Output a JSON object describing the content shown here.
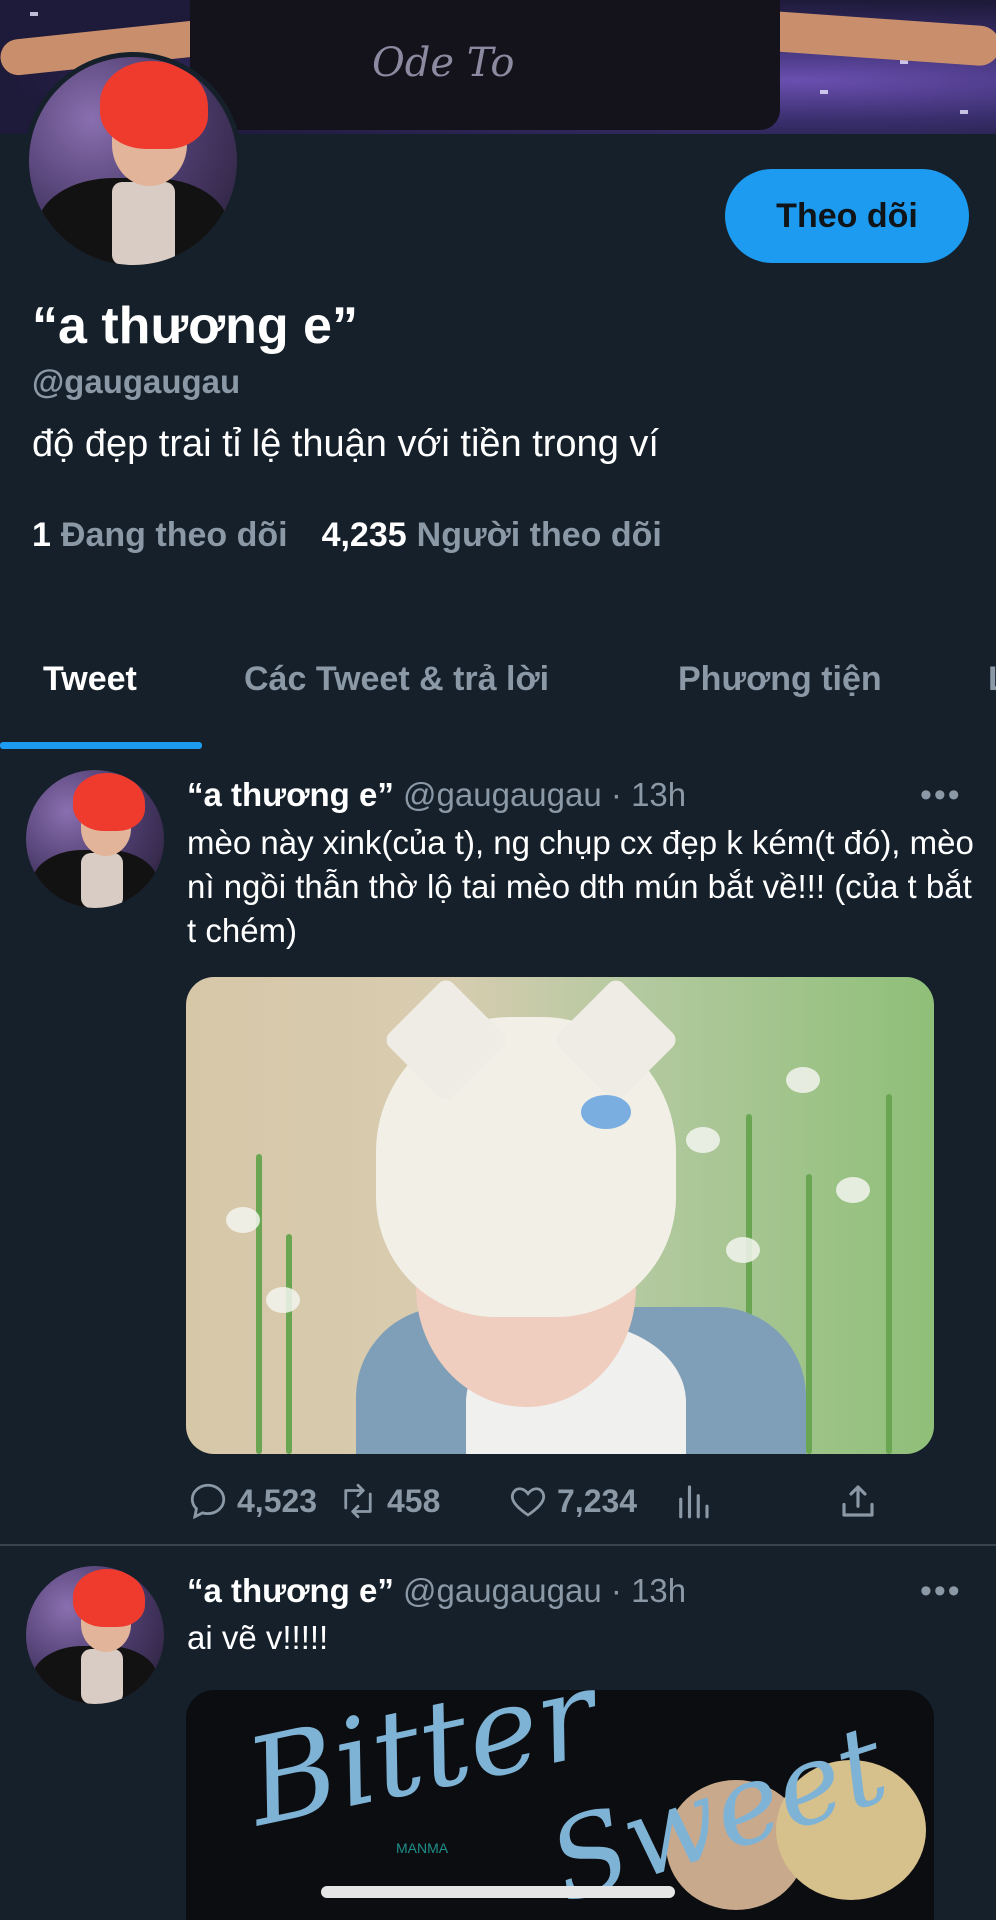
{
  "banner": {
    "signature": "Ode To"
  },
  "profile": {
    "follow_label": "Theo dõi",
    "display_name": "“a thương e”",
    "handle": "@gaugaugau",
    "bio": "độ đẹp trai tỉ lệ thuận với tiền trong ví",
    "following_count": "1",
    "following_label": "Đang theo dõi",
    "followers_count": "4,235",
    "followers_label": "Người theo dõi"
  },
  "tabs": [
    {
      "label": "Tweet",
      "active": true
    },
    {
      "label": "Các Tweet & trả lời",
      "active": false
    },
    {
      "label": "Phương tiện",
      "active": false
    },
    {
      "label": "L",
      "active": false
    }
  ],
  "tweets": [
    {
      "name": "“a thương e”",
      "handle": "@gaugaugau",
      "time": "· 13h",
      "more": "•••",
      "text": "mèo này xink(của t), ng chụp cx đẹp k kém(t đó), mèo nì ngồi thẫn thờ lộ tai mèo dth mún bắt về!!! (của t bắt t chém)",
      "replies": "4,523",
      "retweets": "458",
      "likes": "7,234"
    },
    {
      "name": "“a thương e”",
      "handle": "@gaugaugau",
      "time": "· 13h",
      "more": "•••",
      "text": "ai vẽ v!!!!!",
      "media_title_1": "Bitter",
      "media_title_2": "Sweet",
      "media_watermark": "MANMA"
    }
  ],
  "icons": {
    "reply": "reply-icon",
    "retweet": "retweet-icon",
    "like": "heart-icon",
    "analytics": "analytics-icon",
    "share": "share-icon"
  },
  "colors": {
    "background": "#15202b",
    "accent": "#1d9bf0",
    "secondary_text": "#8b98a5"
  }
}
